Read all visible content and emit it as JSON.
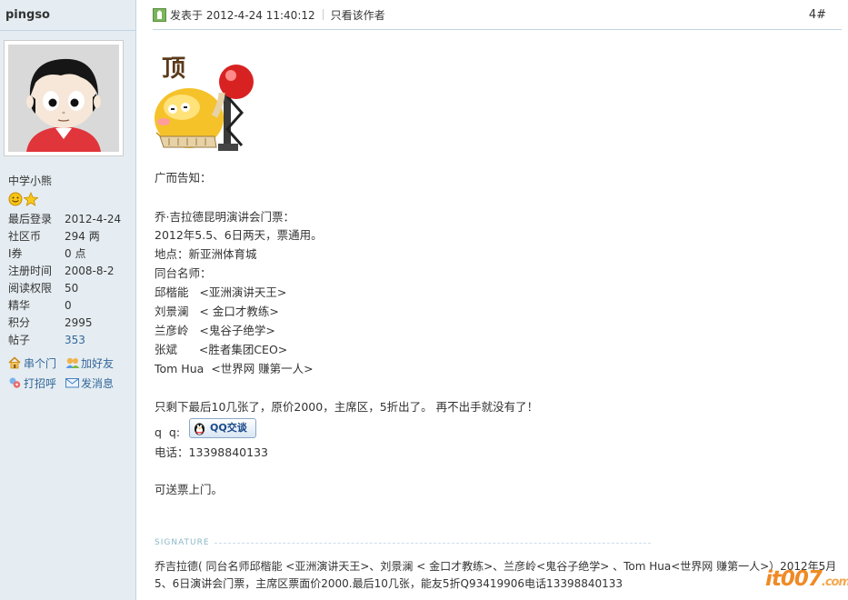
{
  "sidebar": {
    "username": "pingso",
    "rank": "中学小熊",
    "stats": [
      {
        "label": "最后登录",
        "value": "2012-4-24"
      },
      {
        "label": "社区币",
        "value": "294 两"
      },
      {
        "label": "I券",
        "value": "0 点"
      },
      {
        "label": "注册时间",
        "value": "2008-8-2"
      },
      {
        "label": "阅读权限",
        "value": "50"
      },
      {
        "label": "精华",
        "value": "0"
      },
      {
        "label": "积分",
        "value": "2995"
      },
      {
        "label": "帖子",
        "value": "353"
      }
    ],
    "actions": {
      "visit": "串个门",
      "add_friend": "加好友",
      "greet": "打招呼",
      "message": "发消息"
    }
  },
  "post": {
    "date_text": "发表于 2012-4-24 11:40:12",
    "author_only": "只看该作者",
    "floor": "4#",
    "emoticon_label": "顶",
    "lines": [
      "广而告知：",
      "乔·吉拉德昆明演讲会门票：",
      "2012年5.5、6日两天，票通用。",
      "地点：新亚洲体育城",
      "同台名师：",
      "邱楷能   <亚洲演讲天王>",
      "刘景澜   < 金口才教练>",
      "兰彦岭   <鬼谷子绝学>",
      "张斌      <胜者集团CEO>",
      "Tom Hua  <世界网 赚第一人>",
      "只剩下最后10几张了，原价2000，主席区，5折出了。 再不出手就没有了！",
      "q  q:",
      "电话：13398840133",
      "可送票上门。"
    ],
    "qq_button": "QQ交谈"
  },
  "signature": {
    "label": "SIGNATURE",
    "text": "乔吉拉德( 同台名师邱楷能 <亚洲演讲天王>、刘景澜   < 金口才教练>、兰彦岭<鬼谷子绝学> 、Tom Hua<世界网 赚第一人>）2012年5月5、6日演讲会门票，主席区票面价2000.最后10几张，能友5折Q93419906电话13398840133"
  },
  "watermark": {
    "brand": "it007",
    "domain": ".com"
  },
  "colors": {
    "sidebar_bg": "#e5edf2",
    "border": "#c2d5e3",
    "link": "#336699",
    "watermark": "#f08a24"
  }
}
